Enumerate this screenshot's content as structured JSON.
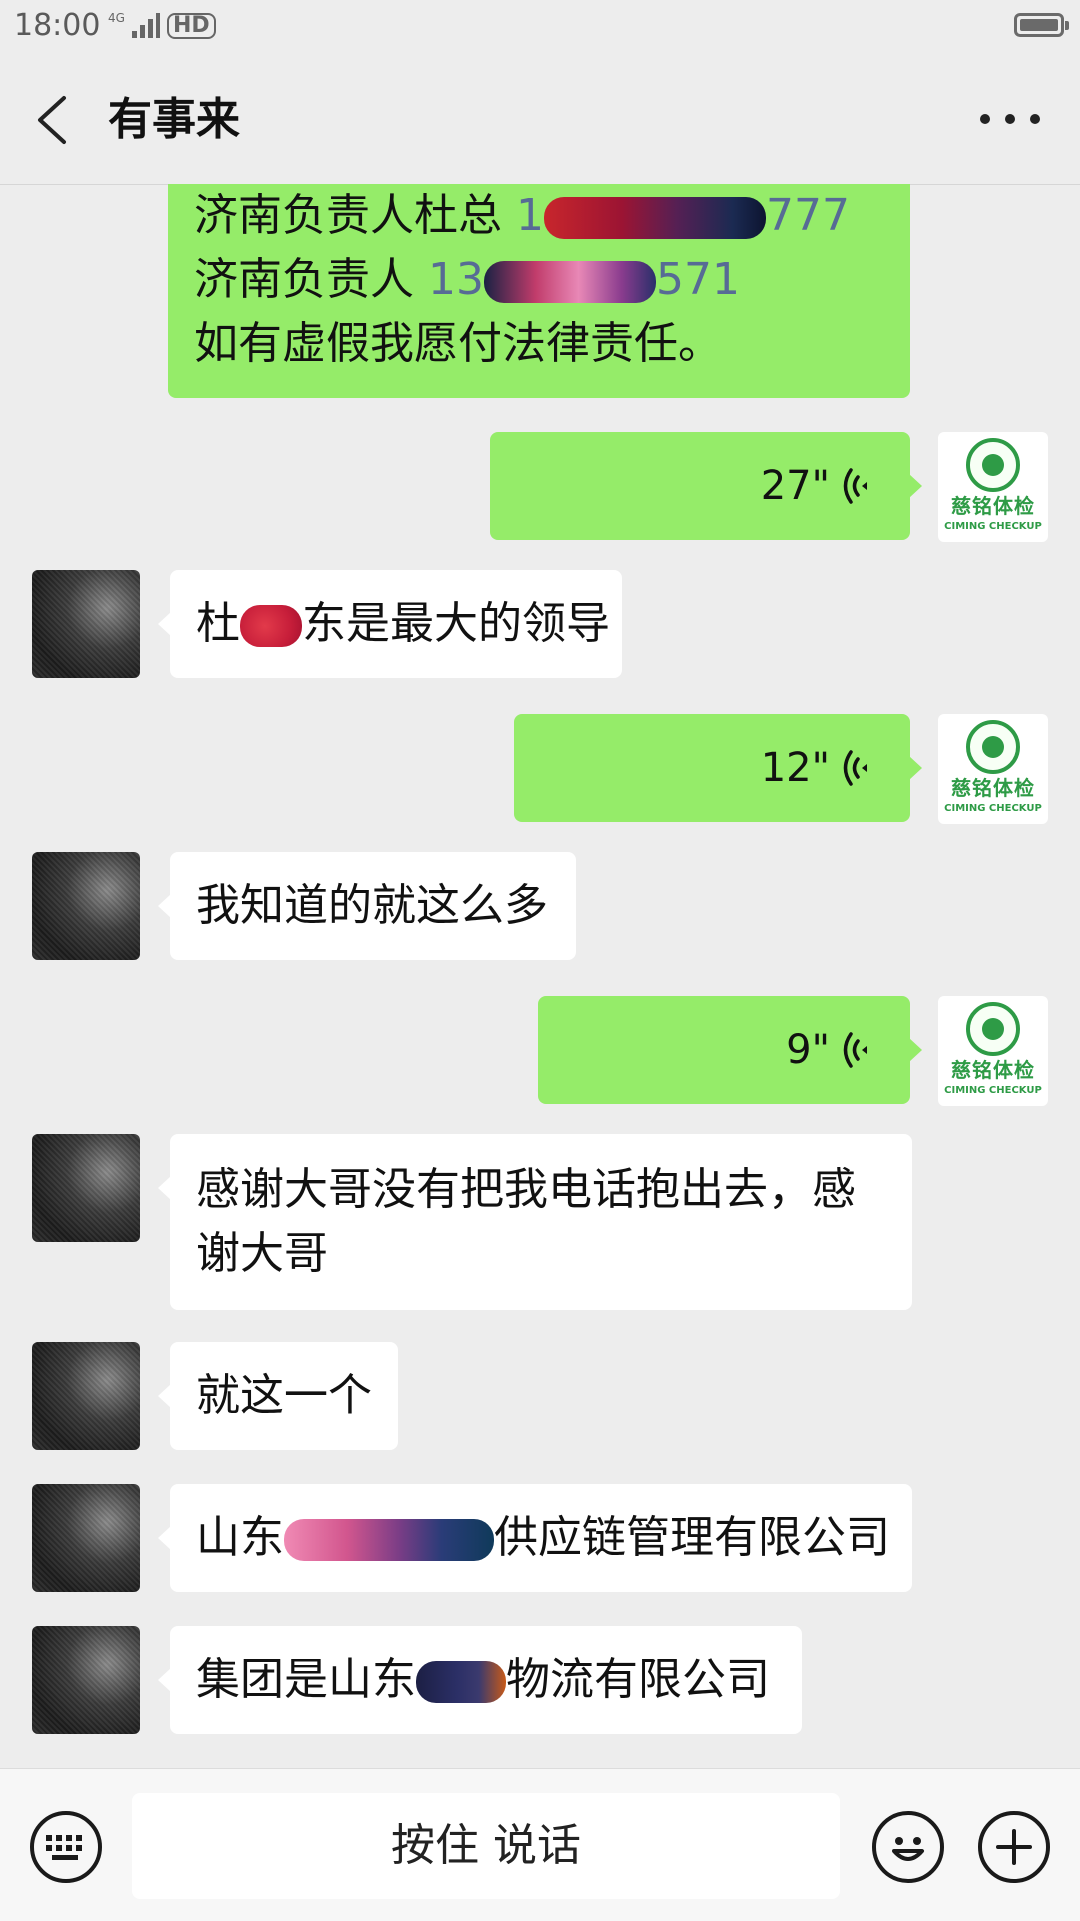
{
  "status_bar": {
    "time": "18:00",
    "network_small": "4G",
    "hd_label": "HD"
  },
  "header": {
    "title": "有事来"
  },
  "messages": [
    {
      "side": "sent",
      "type": "text",
      "lines": [
        {
          "prefix": "济南负责人杜总 ",
          "partial": "1",
          "suffix": "777"
        },
        {
          "prefix": "济南负责人 ",
          "partial": "13",
          "suffix": "571"
        },
        {
          "text": "如有虚假我愿付法律责任。"
        }
      ]
    },
    {
      "side": "sent",
      "type": "voice",
      "duration": "27\""
    },
    {
      "side": "received",
      "type": "text",
      "part1": "杜",
      "part2": "东是最大的领导"
    },
    {
      "side": "sent",
      "type": "voice",
      "duration": "12\""
    },
    {
      "side": "received",
      "type": "text",
      "text": "我知道的就这么多"
    },
    {
      "side": "sent",
      "type": "voice",
      "duration": "9\""
    },
    {
      "side": "received",
      "type": "text",
      "lines": [
        "感谢大哥没有把我电话抱出去，感",
        "谢大哥"
      ]
    },
    {
      "side": "received",
      "type": "text",
      "text": "就这一个"
    },
    {
      "side": "received",
      "type": "text",
      "part1": "山东",
      "part2": "供应链管理有限公司"
    },
    {
      "side": "received",
      "type": "text",
      "part1": "集团是山东",
      "part2": "物流有限公司"
    }
  ],
  "self_avatar": {
    "logo_cn": "慈铭体检",
    "logo_en": "CIMING CHECKUP"
  },
  "input_bar": {
    "hold_to_talk_label": "按住 说话"
  },
  "colors": {
    "sent_bubble": "#95ec69",
    "received_bubble": "#ffffff",
    "background": "#ededed",
    "link_number": "#576b95",
    "logo_green": "#2e9b46"
  },
  "icons": [
    "back-arrow-icon",
    "more-icon",
    "voice-wave-icon",
    "keyboard-icon",
    "emoji-icon",
    "plus-icon",
    "battery-icon",
    "signal-icon"
  ]
}
